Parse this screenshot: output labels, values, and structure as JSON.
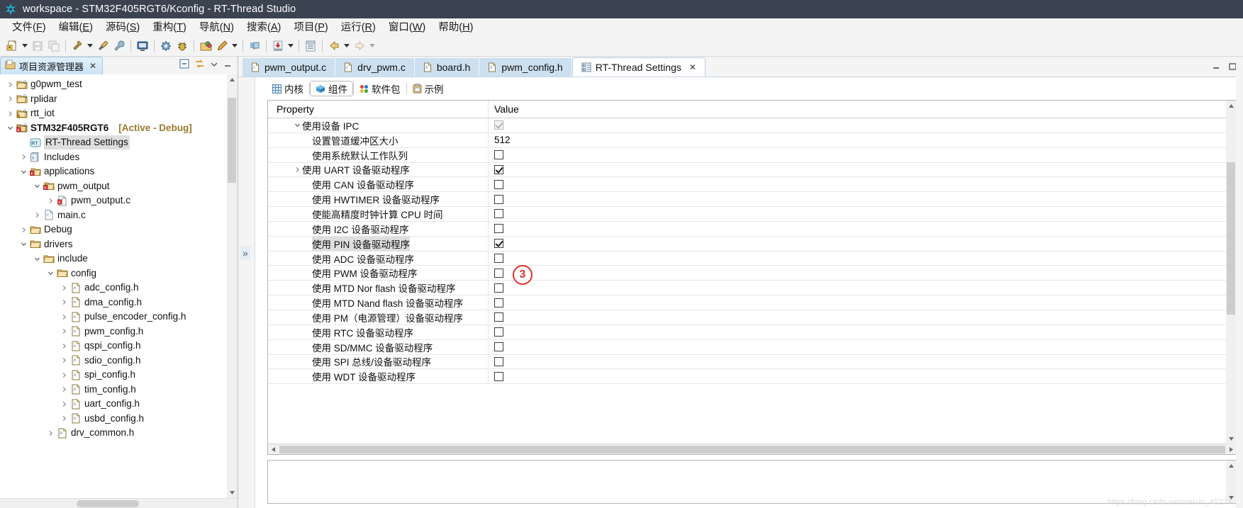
{
  "window": {
    "title": "workspace - STM32F405RGT6/Kconfig - RT-Thread Studio",
    "app_icon": "rt-thread-logo-icon",
    "minimize_label": "—",
    "maximize_label": "□",
    "restore_label": "⧉"
  },
  "menubar": {
    "items": [
      {
        "label": "文件(F)",
        "mnemonic": "F",
        "name": "menu-file"
      },
      {
        "label": "编辑(E)",
        "mnemonic": "E",
        "name": "menu-edit"
      },
      {
        "label": "源码(S)",
        "mnemonic": "S",
        "name": "menu-source"
      },
      {
        "label": "重构(T)",
        "mnemonic": "T",
        "name": "menu-refactor"
      },
      {
        "label": "导航(N)",
        "mnemonic": "N",
        "name": "menu-navigate"
      },
      {
        "label": "搜索(A)",
        "mnemonic": "A",
        "name": "menu-search"
      },
      {
        "label": "项目(P)",
        "mnemonic": "P",
        "name": "menu-project"
      },
      {
        "label": "运行(R)",
        "mnemonic": "R",
        "name": "menu-run"
      },
      {
        "label": "窗口(W)",
        "mnemonic": "W",
        "name": "menu-window"
      },
      {
        "label": "帮助(H)",
        "mnemonic": "H",
        "name": "menu-help"
      }
    ]
  },
  "toolbar": {
    "buttons": [
      {
        "name": "new-file-icon",
        "glyph": "new"
      },
      {
        "name": "new-dropdown-arrow",
        "glyph": "arrow"
      },
      {
        "name": "save-icon",
        "glyph": "save"
      },
      {
        "name": "save-all-icon",
        "glyph": "saveall"
      },
      {
        "name": "build-hammer-icon",
        "glyph": "hammer"
      },
      {
        "name": "build-dropdown-arrow",
        "glyph": "arrow"
      },
      {
        "name": "clean-icon",
        "glyph": "clean"
      },
      {
        "name": "wrench-icon",
        "glyph": "wrench"
      },
      {
        "name": "terminal-icon",
        "glyph": "terminal"
      },
      {
        "name": "settings-gear-icon",
        "glyph": "gear"
      },
      {
        "name": "debug-bug-icon",
        "glyph": "bug"
      },
      {
        "name": "open-package-icon",
        "glyph": "pkg"
      },
      {
        "name": "flash-pen-icon",
        "glyph": "pen"
      },
      {
        "name": "flash-dropdown-arrow",
        "glyph": "arrow"
      },
      {
        "name": "book-icon",
        "glyph": "book"
      },
      {
        "name": "download-icon",
        "glyph": "download"
      },
      {
        "name": "download-dropdown-arrow",
        "glyph": "arrow"
      },
      {
        "name": "register-view-icon",
        "glyph": "list"
      },
      {
        "name": "back-arrow-icon",
        "glyph": "back"
      },
      {
        "name": "back-dropdown-arrow",
        "glyph": "arrow"
      },
      {
        "name": "forward-arrow-icon",
        "glyph": "fwd"
      },
      {
        "name": "forward-dropdown-arrow",
        "glyph": "arrow"
      }
    ]
  },
  "explorer": {
    "tab_label": "项目资源管理器",
    "tab_close": "✕",
    "tools": [
      "collapse-all-icon",
      "link-with-editor-icon",
      "view-menu-icon",
      "minimize-icon"
    ],
    "tree": [
      {
        "indent": 0,
        "twisty": "collapsed",
        "icon": "c-project-folder-icon",
        "label": "g0pwm_test",
        "bold": false,
        "selected": false,
        "tag": ""
      },
      {
        "indent": 0,
        "twisty": "collapsed",
        "icon": "c-project-folder-icon",
        "label": "rplidar",
        "bold": false,
        "selected": false,
        "tag": ""
      },
      {
        "indent": 0,
        "twisty": "collapsed",
        "icon": "c-project-folder-warn-icon",
        "label": "rtt_iot",
        "bold": false,
        "selected": false,
        "tag": ""
      },
      {
        "indent": 0,
        "twisty": "expanded",
        "icon": "c-project-active-icon",
        "label": "STM32F405RGT6",
        "bold": true,
        "selected": false,
        "tag": "[Active - Debug]"
      },
      {
        "indent": 1,
        "twisty": "none",
        "icon": "rt-thread-settings-icon",
        "label": "RT-Thread Settings",
        "bold": false,
        "selected": true,
        "tag": ""
      },
      {
        "indent": 1,
        "twisty": "collapsed",
        "icon": "includes-icon",
        "label": "Includes",
        "bold": false,
        "selected": false,
        "tag": ""
      },
      {
        "indent": 1,
        "twisty": "expanded",
        "icon": "source-folder-icon",
        "label": "applications",
        "bold": false,
        "selected": false,
        "tag": ""
      },
      {
        "indent": 2,
        "twisty": "expanded",
        "icon": "source-folder-icon",
        "label": "pwm_output",
        "bold": false,
        "selected": false,
        "tag": ""
      },
      {
        "indent": 3,
        "twisty": "collapsed",
        "icon": "c-source-excluded-icon",
        "label": "pwm_output.c",
        "bold": false,
        "selected": false,
        "tag": ""
      },
      {
        "indent": 2,
        "twisty": "collapsed",
        "icon": "c-source-icon",
        "label": "main.c",
        "bold": false,
        "selected": false,
        "tag": ""
      },
      {
        "indent": 1,
        "twisty": "collapsed",
        "icon": "folder-icon",
        "label": "Debug",
        "bold": false,
        "selected": false,
        "tag": ""
      },
      {
        "indent": 1,
        "twisty": "expanded",
        "icon": "folder-icon",
        "label": "drivers",
        "bold": false,
        "selected": false,
        "tag": ""
      },
      {
        "indent": 2,
        "twisty": "expanded",
        "icon": "folder-icon",
        "label": "include",
        "bold": false,
        "selected": false,
        "tag": ""
      },
      {
        "indent": 3,
        "twisty": "expanded",
        "icon": "folder-icon",
        "label": "config",
        "bold": false,
        "selected": false,
        "tag": ""
      },
      {
        "indent": 4,
        "twisty": "collapsed",
        "icon": "h-header-icon",
        "label": "adc_config.h",
        "bold": false,
        "selected": false,
        "tag": ""
      },
      {
        "indent": 4,
        "twisty": "collapsed",
        "icon": "h-header-icon",
        "label": "dma_config.h",
        "bold": false,
        "selected": false,
        "tag": ""
      },
      {
        "indent": 4,
        "twisty": "collapsed",
        "icon": "h-header-icon",
        "label": "pulse_encoder_config.h",
        "bold": false,
        "selected": false,
        "tag": ""
      },
      {
        "indent": 4,
        "twisty": "collapsed",
        "icon": "h-header-icon",
        "label": "pwm_config.h",
        "bold": false,
        "selected": false,
        "tag": ""
      },
      {
        "indent": 4,
        "twisty": "collapsed",
        "icon": "h-header-icon",
        "label": "qspi_config.h",
        "bold": false,
        "selected": false,
        "tag": ""
      },
      {
        "indent": 4,
        "twisty": "collapsed",
        "icon": "h-header-icon",
        "label": "sdio_config.h",
        "bold": false,
        "selected": false,
        "tag": ""
      },
      {
        "indent": 4,
        "twisty": "collapsed",
        "icon": "h-header-icon",
        "label": "spi_config.h",
        "bold": false,
        "selected": false,
        "tag": ""
      },
      {
        "indent": 4,
        "twisty": "collapsed",
        "icon": "h-header-icon",
        "label": "tim_config.h",
        "bold": false,
        "selected": false,
        "tag": ""
      },
      {
        "indent": 4,
        "twisty": "collapsed",
        "icon": "h-header-icon",
        "label": "uart_config.h",
        "bold": false,
        "selected": false,
        "tag": ""
      },
      {
        "indent": 4,
        "twisty": "collapsed",
        "icon": "h-header-icon",
        "label": "usbd_config.h",
        "bold": false,
        "selected": false,
        "tag": ""
      },
      {
        "indent": 3,
        "twisty": "collapsed",
        "icon": "h-header-icon",
        "label": "drv_common.h",
        "bold": false,
        "selected": false,
        "tag": ""
      }
    ]
  },
  "editor": {
    "tabs": [
      {
        "label": "pwm_output.c",
        "icon": "c-file-icon",
        "active": false,
        "closable": false
      },
      {
        "label": "drv_pwm.c",
        "icon": "c-file-icon",
        "active": false,
        "closable": false
      },
      {
        "label": "board.h",
        "icon": "h-file-icon",
        "active": false,
        "closable": false
      },
      {
        "label": "pwm_config.h",
        "icon": "h-file-icon",
        "active": false,
        "closable": false
      },
      {
        "label": "RT-Thread Settings",
        "icon": "settings-form-icon",
        "active": true,
        "closable": true,
        "close": "✕"
      }
    ],
    "window_controls": [
      "minimize-icon",
      "maximize-icon"
    ],
    "inner_tabs": [
      {
        "label": "内核",
        "icon": "kernel-grid-icon",
        "active": false
      },
      {
        "label": "组件",
        "icon": "components-box-icon",
        "active": true
      },
      {
        "label": "软件包",
        "icon": "packages-dots-icon",
        "active": false
      },
      {
        "label": "示例",
        "icon": "examples-clipboard-icon",
        "active": false
      }
    ],
    "table": {
      "columns": [
        "Property",
        "Value"
      ],
      "rows": [
        {
          "indent": 2,
          "twisty": "expanded",
          "label": "使用设备 IPC",
          "value_type": "checkbox",
          "checked": true,
          "disabled": true,
          "highlight": false
        },
        {
          "indent": 3,
          "twisty": "none",
          "label": "设置管道缓冲区大小",
          "value_type": "text",
          "value": "512",
          "highlight": false
        },
        {
          "indent": 3,
          "twisty": "none",
          "label": "使用系统默认工作队列",
          "value_type": "checkbox",
          "checked": false,
          "disabled": false,
          "highlight": false
        },
        {
          "indent": 2,
          "twisty": "collapsed",
          "label": "使用 UART 设备驱动程序",
          "value_type": "checkbox",
          "checked": true,
          "disabled": false,
          "highlight": false
        },
        {
          "indent": 3,
          "twisty": "none",
          "label": "使用 CAN 设备驱动程序",
          "value_type": "checkbox",
          "checked": false,
          "disabled": false,
          "highlight": false
        },
        {
          "indent": 3,
          "twisty": "none",
          "label": "使用 HWTIMER 设备驱动程序",
          "value_type": "checkbox",
          "checked": false,
          "disabled": false,
          "highlight": false
        },
        {
          "indent": 3,
          "twisty": "none",
          "label": "使能高精度时钟计算 CPU 时间",
          "value_type": "checkbox",
          "checked": false,
          "disabled": false,
          "highlight": false
        },
        {
          "indent": 3,
          "twisty": "none",
          "label": "使用 I2C 设备驱动程序",
          "value_type": "checkbox",
          "checked": false,
          "disabled": false,
          "highlight": false
        },
        {
          "indent": 3,
          "twisty": "none",
          "label": "使用 PIN 设备驱动程序",
          "value_type": "checkbox",
          "checked": true,
          "disabled": false,
          "highlight": true
        },
        {
          "indent": 3,
          "twisty": "none",
          "label": "使用 ADC 设备驱动程序",
          "value_type": "checkbox",
          "checked": false,
          "disabled": false,
          "highlight": false
        },
        {
          "indent": 3,
          "twisty": "none",
          "label": "使用 PWM 设备驱动程序",
          "value_type": "checkbox",
          "checked": false,
          "disabled": false,
          "highlight": false
        },
        {
          "indent": 3,
          "twisty": "none",
          "label": "使用 MTD Nor flash 设备驱动程序",
          "value_type": "checkbox",
          "checked": false,
          "disabled": false,
          "highlight": false
        },
        {
          "indent": 3,
          "twisty": "none",
          "label": "使用 MTD Nand flash 设备驱动程序",
          "value_type": "checkbox",
          "checked": false,
          "disabled": false,
          "highlight": false
        },
        {
          "indent": 3,
          "twisty": "none",
          "label": "使用 PM（电源管理）设备驱动程序",
          "value_type": "checkbox",
          "checked": false,
          "disabled": false,
          "highlight": false
        },
        {
          "indent": 3,
          "twisty": "none",
          "label": "使用 RTC 设备驱动程序",
          "value_type": "checkbox",
          "checked": false,
          "disabled": false,
          "highlight": false
        },
        {
          "indent": 3,
          "twisty": "none",
          "label": "使用 SD/MMC 设备驱动程序",
          "value_type": "checkbox",
          "checked": false,
          "disabled": false,
          "highlight": false
        },
        {
          "indent": 3,
          "twisty": "none",
          "label": "使用 SPI 总线/设备驱动程序",
          "value_type": "checkbox",
          "checked": false,
          "disabled": false,
          "highlight": false
        },
        {
          "indent": 3,
          "twisty": "none",
          "label": "使用 WDT 设备驱动程序",
          "value_type": "checkbox",
          "checked": false,
          "disabled": false,
          "highlight": false
        }
      ]
    },
    "collapse_chevron": "»"
  },
  "annotation": {
    "label": "3",
    "color": "#e2312b"
  },
  "watermark": "https://blog.csdn.net/weixin_45277...",
  "colors": {
    "titlebar_bg": "#3b4250",
    "accent": "#cde0f0",
    "annotation_red": "#e2312b",
    "active_tag": "#9a7b2e"
  }
}
